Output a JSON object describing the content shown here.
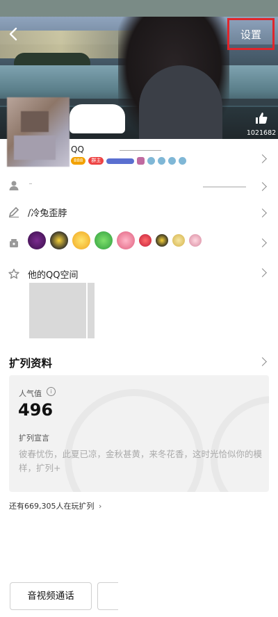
{
  "header": {
    "settings_label": "设置",
    "like_count": "1021682"
  },
  "profile": {
    "name_suffix": "QQ",
    "vip_badge": "888",
    "star_badge": "群主"
  },
  "rows": {
    "signature": "/冷兔歪脖",
    "qzone_label": "他的QQ空间"
  },
  "expand": {
    "section_title": "扩列资料",
    "popularity_label": "人气值",
    "popularity_info": "i",
    "popularity_value": "496",
    "declaration_label": "扩列宣言",
    "declaration_text": "彼春忧伤，此夏已凉，金秋甚黄，来冬花香，这时光恰似你的模样，扩列+",
    "playing_text": "还有669,305人在玩扩列"
  },
  "bottom": {
    "call_button": "音视频通话"
  },
  "colors": {
    "highlight_box": "#e0262c",
    "vip": "#f2a100"
  },
  "icons": [
    "back-icon",
    "thumbs-up-icon",
    "person-icon",
    "pencil-icon",
    "gift-box-icon",
    "star-outline-icon",
    "chevron-right-icon",
    "info-icon"
  ]
}
